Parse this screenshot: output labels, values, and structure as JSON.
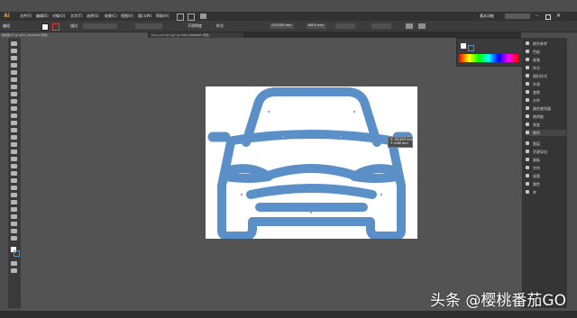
{
  "app": {
    "logo_text": "Ai",
    "workspace_label": "基本功能"
  },
  "menu": [
    "文件(F)",
    "编辑(E)",
    "对象(O)",
    "文字(T)",
    "选择(S)",
    "效果(C)",
    "视图(V)",
    "窗口(W)",
    "帮助(H)"
  ],
  "control": {
    "selection_label": "编组",
    "stroke_label": "描边",
    "opacity_label": "不透明度",
    "style_label": "样式",
    "width_value": "233.359 mm",
    "height_value": "166.5 mm"
  },
  "tabs": [
    {
      "label": "未标题-1* @ 100% (RGB/GPU 预览)",
      "active": true
    },
    {
      "label": "icons_car (2).svg* @ 100% (RGB/GPU 预览)",
      "active": false
    }
  ],
  "measure_tooltip": {
    "x": "X: 95.699 mm",
    "y": "Y: 0.88 mm"
  },
  "panels": [
    "颜色参考",
    "色板",
    "画笔",
    "符号",
    "图形样式",
    "外观",
    "变换",
    "对齐",
    "路径查找器",
    "透明度",
    "渐变",
    "颜色",
    "图层",
    "资源导出",
    "画板",
    "字符",
    "段落",
    "属性",
    "库"
  ],
  "watermark": "头条 @樱桃番茄GO",
  "colors": {
    "car_stroke": "#5b8fc8",
    "accent": "#f7941d"
  }
}
